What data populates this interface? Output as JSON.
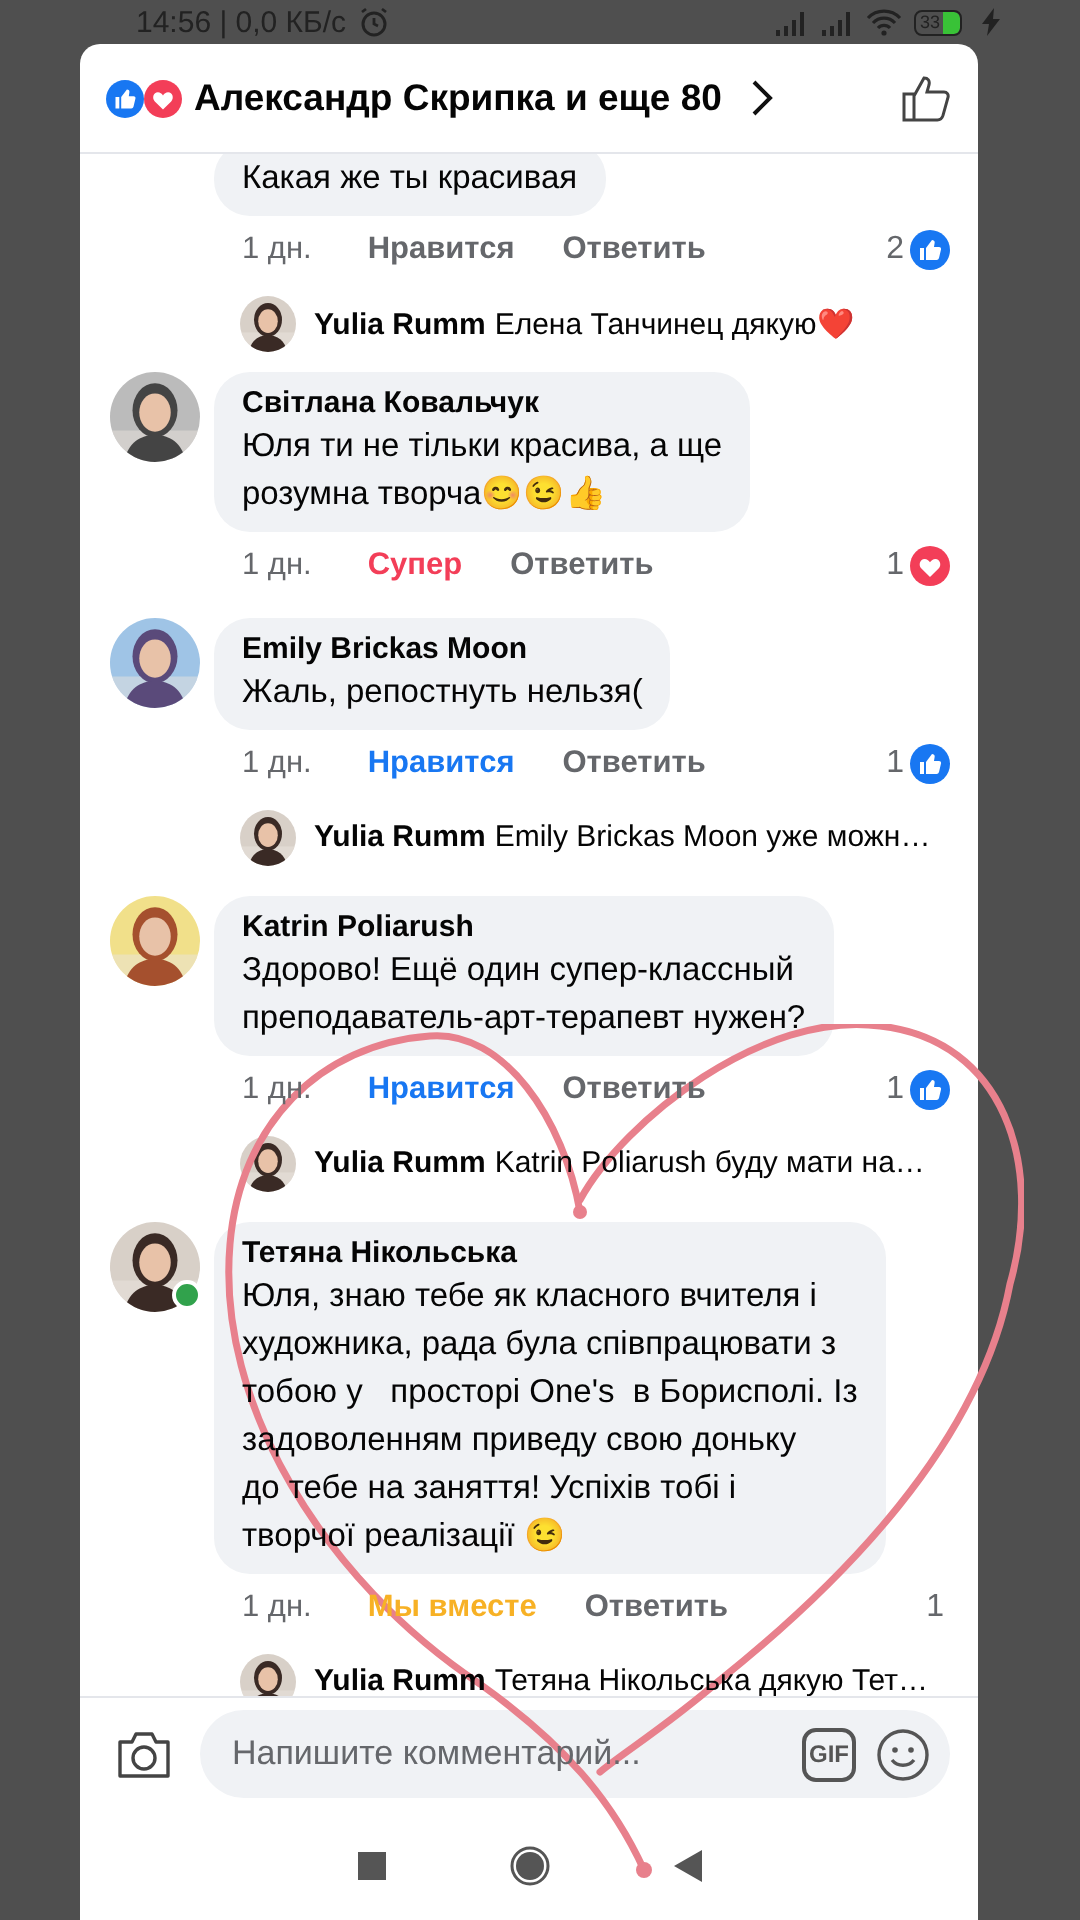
{
  "status_bar": {
    "time": "14:56 | 0,0 КБ/с",
    "battery": "33"
  },
  "header": {
    "title": "Александр Скрипка и еще 80",
    "reactions": [
      {
        "kind": "like"
      },
      {
        "kind": "love"
      }
    ]
  },
  "comments": [
    {
      "text": "Какая же ты красивая",
      "time": "1 дн.",
      "reaction": {
        "label": "Нравится",
        "kind": "none"
      },
      "reply_label": "Ответить",
      "count": {
        "value": "2",
        "kind": "like"
      },
      "reply": {
        "author": "Yulia Rumm",
        "text": "Елена Танчинец дякую❤️"
      }
    },
    {
      "author": "Світлана Ковальчук",
      "online": false,
      "text": "Юля ти не тільки красива, а ще\nрозумна творча😊😉👍",
      "time": "1 дн.",
      "reaction": {
        "label": "Супер",
        "kind": "love"
      },
      "reply_label": "Ответить",
      "count": {
        "value": "1",
        "kind": "love"
      }
    },
    {
      "author": "Emily Brickas Moon",
      "online": false,
      "text": "Жаль, репостнуть нельзя(",
      "time": "1 дн.",
      "reaction": {
        "label": "Нравится",
        "kind": "like"
      },
      "reply_label": "Ответить",
      "count": {
        "value": "1",
        "kind": "like"
      },
      "reply": {
        "author": "Yulia Rumm",
        "text": "Emily Brickas Moon уже можн…"
      }
    },
    {
      "author": "Katrin Poliarush",
      "online": false,
      "text": "Здорово! Ещё один супер-классный\nпреподаватель-арт-терапевт нужен?",
      "time": "1 дн.",
      "reaction": {
        "label": "Нравится",
        "kind": "like"
      },
      "reply_label": "Ответить",
      "count": {
        "value": "1",
        "kind": "like"
      },
      "reply": {
        "author": "Yulia Rumm",
        "text": "Katrin Poliarush буду мати на…"
      }
    },
    {
      "author": "Тетяна Нікольська",
      "online": true,
      "text": "Юля, знаю тебе як класного вчителя і\nхудожника, рада була співпрацювати з\nтобою у   просторі One's  в Борисполі. Із\nзадоволенням приведу свою доньку\nдо тебе на заняття! Успіхів тобі і\nтворчої реалізації 😉",
      "time": "1 дн.",
      "reaction": {
        "label": "Мы вместе",
        "kind": "care"
      },
      "reply_label": "Ответить",
      "count": {
        "value": "1"
      },
      "reply": {
        "author": "Yulia Rumm",
        "text": "Тетяна Нікольська дякую Тет…"
      }
    }
  ],
  "composer": {
    "placeholder": "Напишите комментарий...",
    "gif": "GIF"
  }
}
